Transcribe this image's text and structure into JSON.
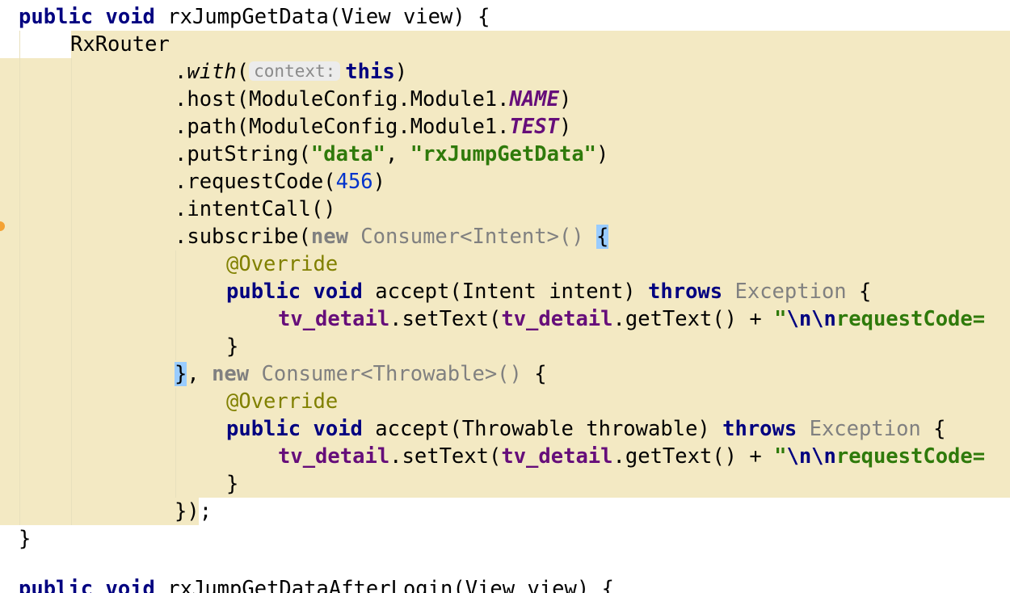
{
  "code": {
    "method_decl": {
      "kw1": "public",
      "kw2": "void",
      "rest": "rxJumpGetData(View view) {"
    },
    "router": "RxRouter",
    "with_call": {
      "pre": ".",
      "name": "with",
      "open": "(",
      "hint": "context:",
      "arg": "this",
      "close": ")"
    },
    "host_call": {
      "pre": ".host(ModuleConfig.Module1.",
      "const": "NAME",
      "post": ")"
    },
    "path_call": {
      "pre": ".path(ModuleConfig.Module1.",
      "const": "TEST",
      "post": ")"
    },
    "putstring_call": {
      "pre": ".putString(",
      "s1": "\"data\"",
      "sep": ", ",
      "s2": "\"rxJumpGetData\"",
      "post": ")"
    },
    "requestcode_call": {
      "pre": ".requestCode(",
      "num": "456",
      "post": ")"
    },
    "intentcall": ".intentCall()",
    "subscribe_call": {
      "pre": ".subscribe(",
      "new_kw": "new",
      "type": " Consumer<Intent>()",
      "space": " ",
      "brace": "{"
    },
    "override": "@Override",
    "accept1": {
      "kw1": "public",
      "kw2": "void",
      "sig": " accept(Intent intent) ",
      "throws": "throws",
      "exc": " Exception",
      "end": " {"
    },
    "settext1": {
      "f1": "tv_detail",
      "mid": ".setText(",
      "f2": "tv_detail",
      "rest": ".getText() + ",
      "quote": "\"",
      "esc": "\\n\\n",
      "str": "requestCode="
    },
    "close_brace": "}",
    "second_consumer": {
      "brace": "}",
      "comma": ", ",
      "new_kw": "new",
      "type": " Consumer<Throwable>()",
      "end": " {"
    },
    "accept2": {
      "kw1": "public",
      "kw2": "void",
      "sig": " accept(Throwable throwable) ",
      "throws": "throws",
      "exc": " Exception",
      "end": " {"
    },
    "settext2": {
      "f1": "tv_detail",
      "mid": ".setText(",
      "f2": "tv_detail",
      "rest": ".getText() + ",
      "quote": "\"",
      "esc": "\\n\\n",
      "str": "requestCode="
    },
    "close_call": "});",
    "method_close": "}",
    "next_method": {
      "kw1": "public",
      "kw2": "void",
      "rest": "rxJumpGetDataAfterLogin(View view) {"
    }
  },
  "colors": {
    "highlight_background": "#f3e9c3",
    "keyword": "#000080",
    "string": "#2f7a0b",
    "number": "#0033cc",
    "field": "#660e7a",
    "annotation": "#808000",
    "brace_match": "#99ccff",
    "gutter_marker": "#f4a234"
  }
}
